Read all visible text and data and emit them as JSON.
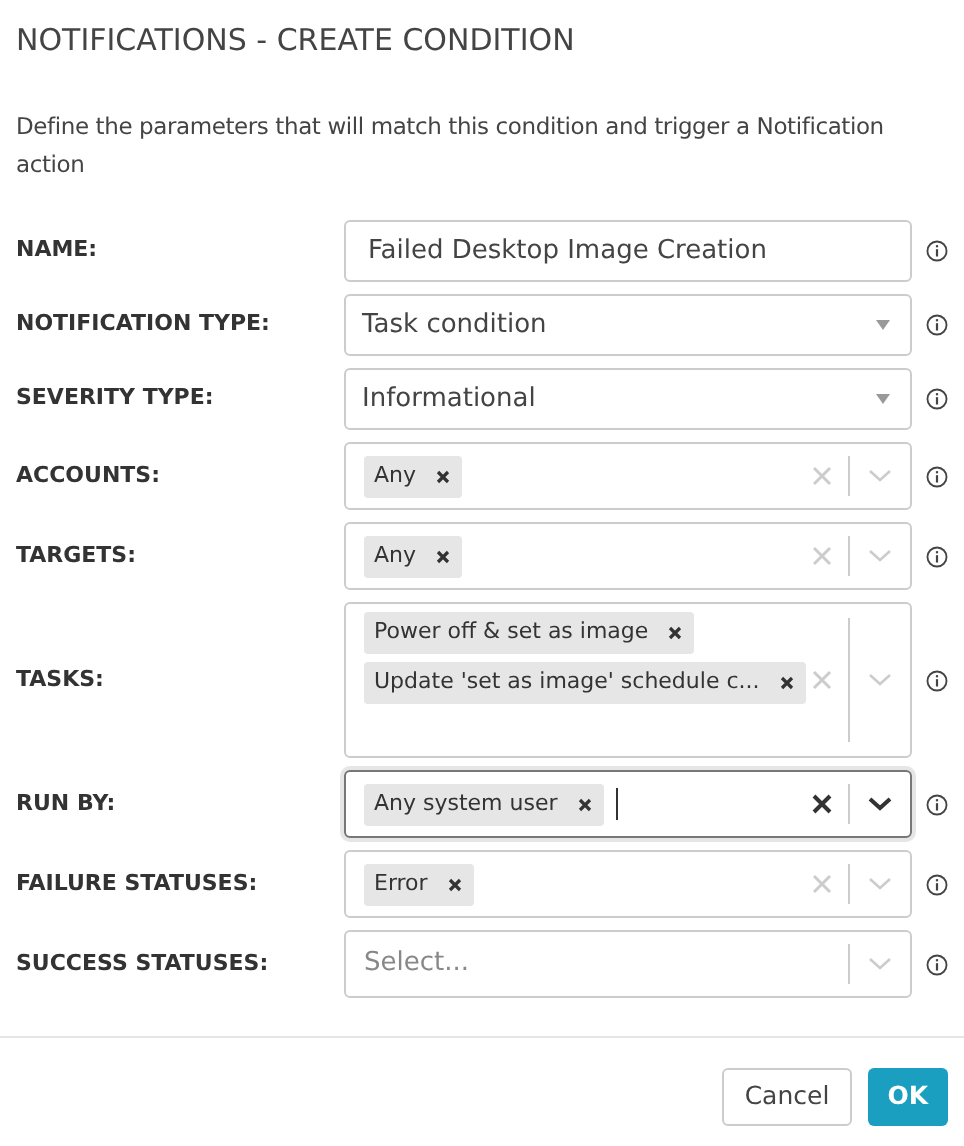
{
  "title": "NOTIFICATIONS - CREATE CONDITION",
  "description": "Define the parameters that will match this condition and trigger a Notification action",
  "fields": [
    {
      "label": "NAME:",
      "kind": "text",
      "value": "Failed Desktop Image Creation",
      "focused": false
    },
    {
      "label": "NOTIFICATION TYPE:",
      "kind": "select",
      "value": "Task condition",
      "focused": false
    },
    {
      "label": "SEVERITY TYPE:",
      "kind": "select",
      "value": "Informational",
      "focused": false
    },
    {
      "label": "ACCOUNTS:",
      "kind": "multi",
      "tags": [
        "Any"
      ],
      "focused": false
    },
    {
      "label": "TARGETS:",
      "kind": "multi",
      "tags": [
        "Any"
      ],
      "focused": false
    },
    {
      "label": "TASKS:",
      "kind": "multi",
      "tags": [
        "Power off & set as image",
        "Update 'set as image' schedule c..."
      ],
      "focused": false
    },
    {
      "label": "RUN BY:",
      "kind": "multi",
      "tags": [
        "Any system user"
      ],
      "focused": true
    },
    {
      "label": "FAILURE STATUSES:",
      "kind": "multi",
      "tags": [
        "Error"
      ],
      "focused": false
    },
    {
      "label": "SUCCESS STATUSES:",
      "kind": "multi",
      "placeholder": "Select...",
      "focused": false
    }
  ],
  "buttons": {
    "cancel": "Cancel",
    "ok": "OK"
  }
}
